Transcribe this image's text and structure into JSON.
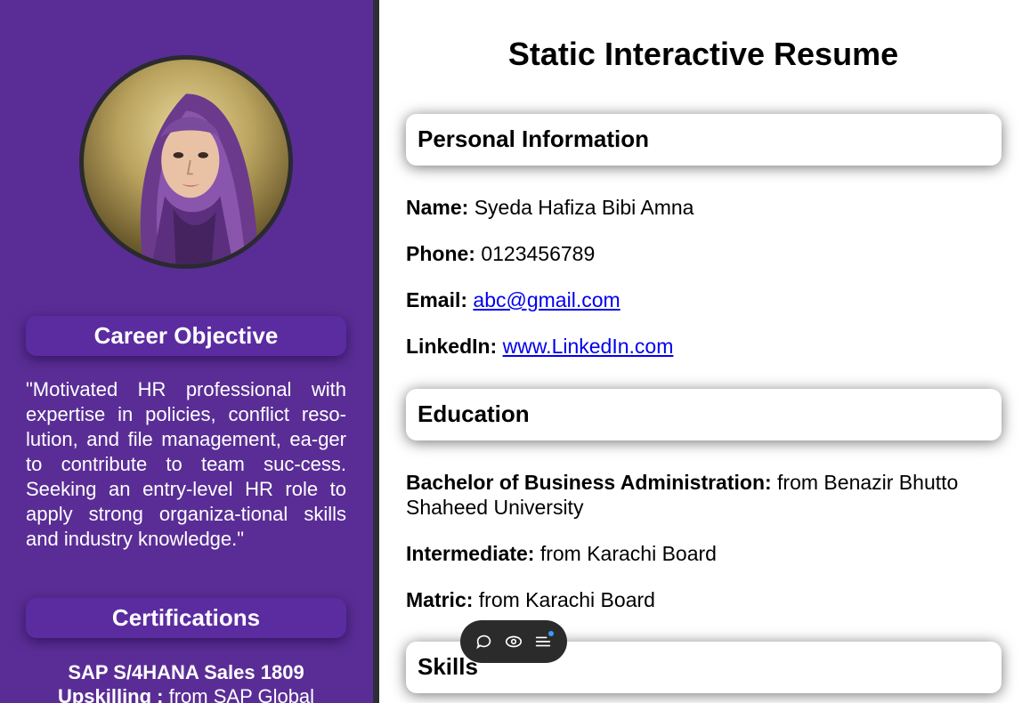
{
  "sidebar": {
    "career_heading": "Career Objective",
    "objective_text": "\"Motivated HR professional with expertise in policies, conflict reso-lution, and file management, ea-ger to contribute to team suc-cess. Seeking an entry-level HR role to apply strong organiza-tional skills and industry knowledge.\"",
    "certifications_heading": "Certifications",
    "certification": {
      "title": "SAP S/4HANA Sales 1809 Upskilling :",
      "detail": " from SAP Global"
    }
  },
  "main": {
    "title": "Static Interactive Resume",
    "personal": {
      "heading": "Personal Information",
      "name_label": "Name:",
      "name_value": " Syeda Hafiza Bibi Amna",
      "phone_label": "Phone:",
      "phone_value": " 0123456789",
      "email_label": "Email:",
      "email_value": "abc@gmail.com",
      "linkedin_label": "LinkedIn:",
      "linkedin_value": "www.LinkedIn.com"
    },
    "education": {
      "heading": "Education",
      "items": [
        {
          "label": "Bachelor of Business Administration:",
          "value": " from Benazir Bhutto Shaheed University"
        },
        {
          "label": "Intermediate:",
          "value": " from Karachi Board"
        },
        {
          "label": "Matric:",
          "value": " from Karachi Board"
        }
      ]
    },
    "skills": {
      "heading": "Skills"
    }
  },
  "toolbar": {
    "icons": [
      "comment-icon",
      "eye-icon",
      "menu-icon"
    ]
  },
  "colors": {
    "sidebar_bg": "#5a2d96",
    "link": "#0000ee",
    "toolbar_bg": "#2b2b2b",
    "notification_dot": "#3b9cff"
  }
}
